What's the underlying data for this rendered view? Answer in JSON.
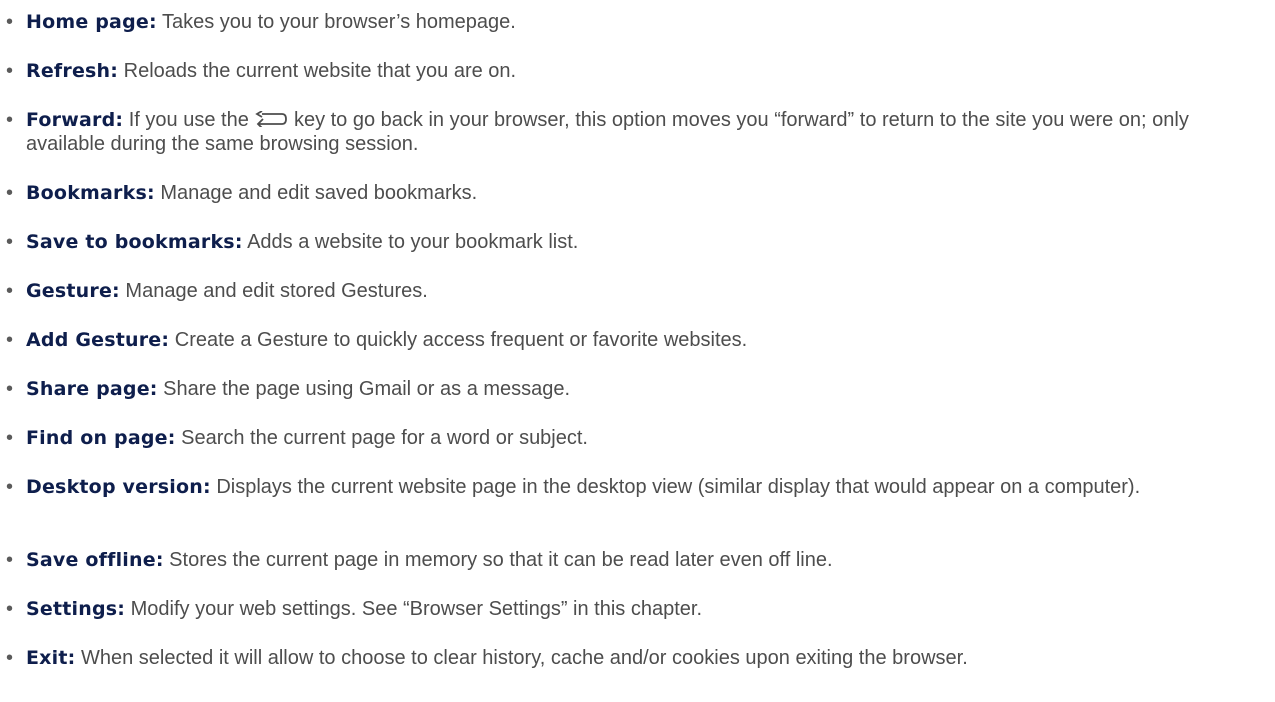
{
  "bullet": "•",
  "items": [
    {
      "term": "Home page:",
      "desc": " Takes you to your browser’s homepage."
    },
    {
      "term": "Refresh:",
      "desc": " Reloads the current website that you are on."
    },
    {
      "term": "Forward:",
      "desc_a": " If you use the ",
      "icon": "back-arrow-icon",
      "desc_b": " key to go back in your browser, this option moves you “forward” to return to the site you were on; only available during the same browsing session."
    },
    {
      "term": "Bookmarks:",
      "desc": " Manage and edit saved bookmarks."
    },
    {
      "term": "Save to bookmarks:",
      "desc": " Adds a website to your bookmark list."
    },
    {
      "term": "Gesture:",
      "desc": " Manage and edit stored Gestures."
    },
    {
      "term": "Add Gesture:",
      "desc": " Create a Gesture to quickly access frequent or favorite websites."
    },
    {
      "term": "Share page:",
      "desc": " Share the page using Gmail or as a message."
    },
    {
      "term": "Find on page:",
      "desc": " Search the current page for a word or subject."
    },
    {
      "term": "Desktop version:",
      "desc": " Displays the current website page in the desktop view (similar display that would appear on a computer)."
    },
    {
      "term": "Save offline:",
      "desc": " Stores the current page in memory so that it can be read later even off line."
    },
    {
      "term": "Settings:",
      "desc": " Modify your web settings. See “Browser Settings” in this chapter."
    },
    {
      "term": "Exit:",
      "desc": " When selected it will allow to choose to clear history, cache and/or cookies upon exiting the browser."
    }
  ]
}
